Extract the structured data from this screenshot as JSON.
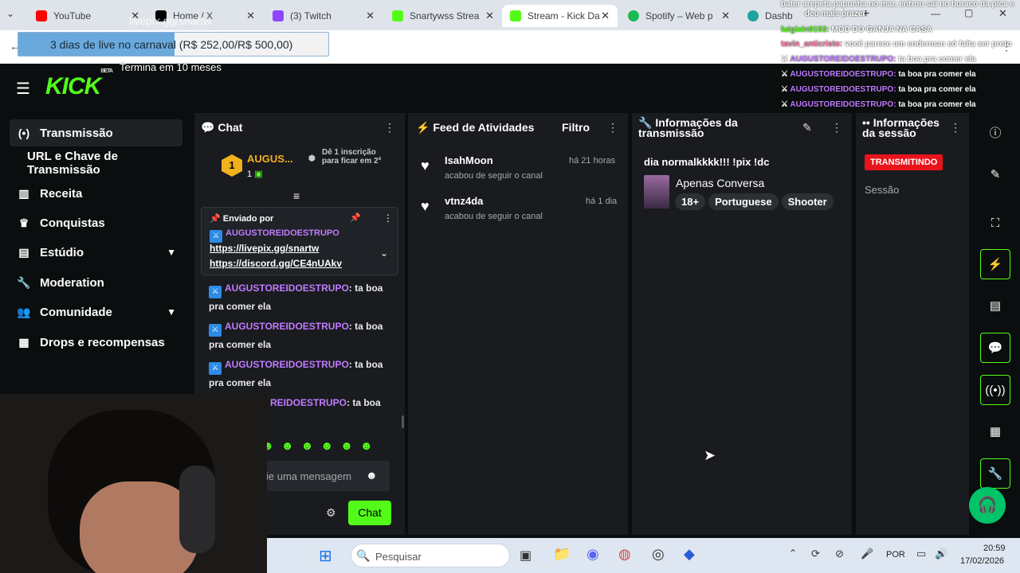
{
  "browser": {
    "tabs": [
      {
        "label": "YouTube",
        "color": "#ff0000"
      },
      {
        "label": "Home / X",
        "color": "#000000"
      },
      {
        "label": "(3) Twitch",
        "color": "#9146ff"
      },
      {
        "label": "Snartywss Strea",
        "color": "#53fc18"
      },
      {
        "label": "Stream - Kick Da",
        "color": "#53fc18"
      },
      {
        "label": "Spotify – Web p",
        "color": "#1db954"
      },
      {
        "label": "Dashb",
        "color": "#1da1a1"
      }
    ]
  },
  "overlay": {
    "livepix_url": "livepix.gg/snartw",
    "goal_text": "3 dias de live no carnaval (R$ 252,00/R$ 500,00)",
    "goal_progress": 0.504,
    "goal_subtext": "Termina em 10 meses",
    "chat_lines": [
      {
        "user": "",
        "text": "bater arepeta papunha no mar, entrou sai no buraco da pica e"
      },
      {
        "user": "",
        "text": "deu mais prazer"
      },
      {
        "user": "luigixin0153:",
        "text": "MOD DO GANJA NA CASA"
      },
      {
        "user": "tavin_anticristo:",
        "text": "você parece um enderman só falta ser preto"
      },
      {
        "user": "AUGUSTOREIDOESTRUPO:",
        "text": "ta boa pra comer ela"
      },
      {
        "user": "AUGUSTOREIDOESTRUPO:",
        "text": "ta boa pra comer ela"
      },
      {
        "user": "AUGUSTOREIDOESTRUPO:",
        "text": "ta boa pra comer ela"
      },
      {
        "user": "AUGUSTOREIDOESTRUPO:",
        "text": "ta boa pra comer ela"
      }
    ]
  },
  "kick": {
    "logo": "KICK",
    "logo_sup": "BETA",
    "nav": [
      {
        "label": "Transmissão",
        "icon": "broadcast-icon"
      },
      {
        "label": "URL e Chave de Transmissão",
        "icon": ""
      },
      {
        "label": "Receita",
        "icon": "revenue-icon"
      },
      {
        "label": "Conquistas",
        "icon": "trophy-icon"
      },
      {
        "label": "Estúdio",
        "icon": "studio-icon"
      },
      {
        "label": "Moderation",
        "icon": "wrench-icon"
      },
      {
        "label": "Comunidade",
        "icon": "community-icon"
      },
      {
        "label": "Drops e recompensas",
        "icon": "drops-icon"
      }
    ],
    "chat": {
      "title": "Chat",
      "top_gifter": "AUGUS...",
      "top_gifter_rank": "1",
      "top_gifter_count": "1",
      "gift_prompt": "Dê 1 inscrição para ficar em 2º",
      "pinned_label": "Enviado por",
      "pinned_user": "AUGUSTOREIDOESTRUPO",
      "pinned_links": [
        "https://livepix.gg/snartw",
        "https://discord.gg/CE4nUAkv"
      ],
      "messages": [
        {
          "user": "AUGUSTOREIDOESTRUPO",
          "text": ": ta boa pra comer ela"
        },
        {
          "user": "AUGUSTOREIDOESTRUPO",
          "text": ": ta boa pra comer ela"
        },
        {
          "user": "AUGUSTOREIDOESTRUPO",
          "text": ": ta boa pra comer ela"
        },
        {
          "user": "REIDOESTRUPO",
          "text": ": ta boa"
        }
      ],
      "input_placeholder": "ie uma mensagem",
      "send_label": "Chat"
    },
    "feed": {
      "title": "Feed de Atividades",
      "filter_label": "Filtro",
      "items": [
        {
          "user": "IsahMoon",
          "action": "acabou de seguir o canal",
          "time": "há 21 horas"
        },
        {
          "user": "vtnz4da",
          "action": "acabou de seguir o canal",
          "time": "há 1 dia"
        }
      ]
    },
    "stream_info": {
      "title": "Informações da transmissão",
      "stream_title": "dia normalkkkk!!! !pix !dc",
      "category": "Apenas Conversa",
      "tags": [
        "18+",
        "Portuguese",
        "Shooter"
      ]
    },
    "session": {
      "title": "Informações da sessão",
      "status": "TRANSMITINDO",
      "label": "Sessão"
    }
  },
  "taskbar": {
    "search_placeholder": "Pesquisar",
    "language": "POR",
    "time": "20:59",
    "date": "17/02/2026"
  }
}
